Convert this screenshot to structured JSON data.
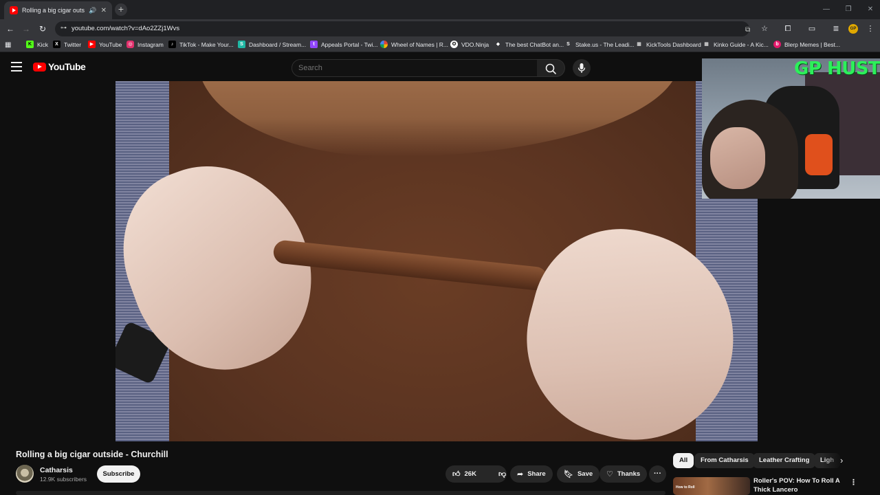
{
  "browser": {
    "tab": {
      "title": "Rolling a big cigar outside"
    },
    "address_bar": {
      "url": "youtube.com/watch?v=dAo2ZZj1Wvs"
    },
    "bookmarks": [
      {
        "label": "Kick",
        "icon": "kick-icon",
        "color": "#53fc18"
      },
      {
        "label": "Twitter",
        "icon": "x-icon",
        "color": "#000000"
      },
      {
        "label": "YouTube",
        "icon": "youtube-icon",
        "color": "#ff0000"
      },
      {
        "label": "Instagram",
        "icon": "instagram-icon",
        "color": "#e1306c"
      },
      {
        "label": "TikTok - Make Your...",
        "icon": "tiktok-icon",
        "color": "#000000"
      },
      {
        "label": "Dashboard / Stream...",
        "icon": "streamelements-icon",
        "color": "#1fb7a4"
      },
      {
        "label": "Appeals Portal - Twi...",
        "icon": "twitch-icon",
        "color": "#9146ff"
      },
      {
        "label": "Wheel of Names | R...",
        "icon": "wheel-icon",
        "color": "#db4437"
      },
      {
        "label": "VDO.Ninja",
        "icon": "vdo-ninja-icon",
        "color": "#ffffff"
      },
      {
        "label": "The best ChatBot an...",
        "icon": "chatbot-icon",
        "color": "#ffffff"
      },
      {
        "label": "Stake.us - The Leadi...",
        "icon": "stake-icon",
        "color": "#ffffff"
      },
      {
        "label": "KickTools Dashboard",
        "icon": "grid-icon",
        "color": "#ffffff"
      },
      {
        "label": "Kinko Guide - A Kic...",
        "icon": "grid-icon",
        "color": "#ffffff"
      },
      {
        "label": "Blerp Memes | Best...",
        "icon": "blerp-icon",
        "color": "#e4176a"
      }
    ]
  },
  "youtube": {
    "logo_text": "YouTube",
    "search": {
      "placeholder": "Search"
    },
    "video": {
      "title": "Rolling a big cigar outside - Churchill",
      "channel": "Catharsis",
      "subscribers": "12.9K subscribers",
      "subscribe_label": "Subscribe",
      "likes": "26K",
      "share_label": "Share",
      "save_label": "Save",
      "thanks_label": "Thanks"
    },
    "overlay": {
      "webcam_text": "GP HUSTLA"
    },
    "chips": [
      "All",
      "From Catharsis",
      "Leather Crafting",
      "Ligh"
    ],
    "recommendation": {
      "title": "Roller's POV: How To Roll A Thick Lancero",
      "thumb_text": "How to Roll"
    }
  },
  "colors": {
    "accent": "#ff0000",
    "background": "#0f0f0f",
    "overlay_text": "#2cf05a"
  }
}
